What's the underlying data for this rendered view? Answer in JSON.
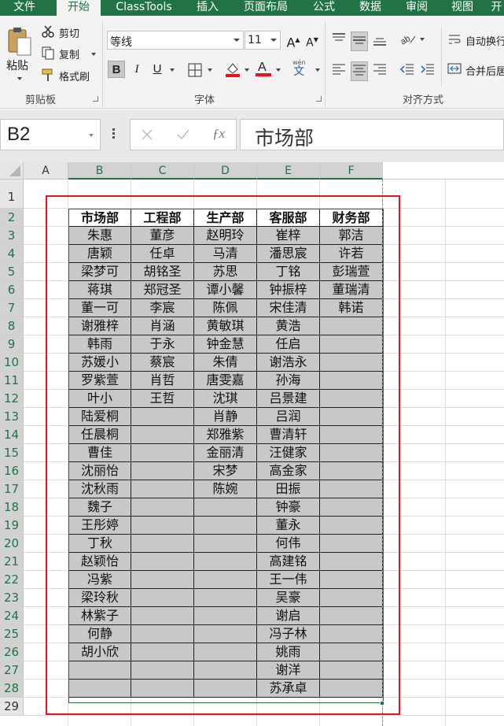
{
  "ribbon": {
    "tabs": [
      {
        "label": "文件",
        "active": false
      },
      {
        "label": "开始",
        "active": true
      },
      {
        "label": "ClassTools",
        "active": false
      },
      {
        "label": "插入",
        "active": false
      },
      {
        "label": "页面布局",
        "active": false
      },
      {
        "label": "公式",
        "active": false
      },
      {
        "label": "数据",
        "active": false
      },
      {
        "label": "审阅",
        "active": false
      },
      {
        "label": "视图",
        "active": false
      },
      {
        "label": "开",
        "active": false
      }
    ],
    "clipboard": {
      "paste_label": "粘贴",
      "cut_label": "剪切",
      "copy_label": "复制",
      "format_painter_label": "格式刷",
      "group_label": "剪贴板"
    },
    "font": {
      "font_name": "等线",
      "font_size": "11",
      "group_label": "字体",
      "phonetic_top": "wén",
      "phonetic_char": "文"
    },
    "alignment": {
      "wrap_text_label": "自动换行",
      "merge_label": "合并后居中",
      "group_label": "对齐方式"
    }
  },
  "formula_bar": {
    "name_box": "B2",
    "formula": "市场部"
  },
  "sheet": {
    "columns": [
      "A",
      "B",
      "C",
      "D",
      "E",
      "F"
    ],
    "selected_columns": [
      "B",
      "C",
      "D",
      "E",
      "F"
    ],
    "rows": [
      1,
      2,
      3,
      4,
      5,
      6,
      7,
      8,
      9,
      10,
      11,
      12,
      13,
      14,
      15,
      16,
      17,
      18,
      19,
      20,
      21,
      22,
      23,
      24,
      25,
      26,
      27,
      28,
      29
    ],
    "table": {
      "headers": [
        "市场部",
        "工程部",
        "生产部",
        "客服部",
        "财务部"
      ],
      "rows": [
        [
          "朱惠",
          "董彦",
          "赵明玲",
          "崔梓",
          "郭洁"
        ],
        [
          "唐颖",
          "任卓",
          "马清",
          "潘思宸",
          "许若"
        ],
        [
          "梁梦可",
          "胡铭圣",
          "苏思",
          "丁铭",
          "彭瑞萱"
        ],
        [
          "蒋琪",
          "郑冠圣",
          "谭小馨",
          "钟振梓",
          "董瑞清"
        ],
        [
          "董一可",
          "李宸",
          "陈佩",
          "宋佳清",
          "韩诺"
        ],
        [
          "谢雅梓",
          "肖涵",
          "黄敏琪",
          "黄浩",
          ""
        ],
        [
          "韩雨",
          "于永",
          "钟金慧",
          "任启",
          ""
        ],
        [
          "苏媛小",
          "蔡宸",
          "朱倩",
          "谢浩永",
          ""
        ],
        [
          "罗紫萱",
          "肖哲",
          "唐雯嘉",
          "孙海",
          ""
        ],
        [
          "叶小",
          "王哲",
          "沈琪",
          "吕景建",
          ""
        ],
        [
          "陆爱桐",
          "",
          "肖静",
          "吕润",
          ""
        ],
        [
          "任晨桐",
          "",
          "郑雅紫",
          "曹清轩",
          ""
        ],
        [
          "曹佳",
          "",
          "金丽清",
          "汪健家",
          ""
        ],
        [
          "沈丽怡",
          "",
          "宋梦",
          "高金家",
          ""
        ],
        [
          "沈秋雨",
          "",
          "陈婉",
          "田振",
          ""
        ],
        [
          "魏子",
          "",
          "",
          "钟豪",
          ""
        ],
        [
          "王彤婷",
          "",
          "",
          "董永",
          ""
        ],
        [
          "丁秋",
          "",
          "",
          "何伟",
          ""
        ],
        [
          "赵颖怡",
          "",
          "",
          "高建铭",
          ""
        ],
        [
          "冯紫",
          "",
          "",
          "王一伟",
          ""
        ],
        [
          "梁玲秋",
          "",
          "",
          "吴豪",
          ""
        ],
        [
          "林紫子",
          "",
          "",
          "谢启",
          ""
        ],
        [
          "何静",
          "",
          "",
          "冯子林",
          ""
        ],
        [
          "胡小欣",
          "",
          "",
          "姚雨",
          ""
        ],
        [
          "",
          "",
          "",
          "谢洋",
          ""
        ],
        [
          "",
          "",
          "",
          "苏承卓",
          ""
        ]
      ]
    }
  },
  "colors": {
    "excel_green": "#217346",
    "highlight_red": "#e5141d",
    "cell_fill": "#c8c8c8"
  }
}
